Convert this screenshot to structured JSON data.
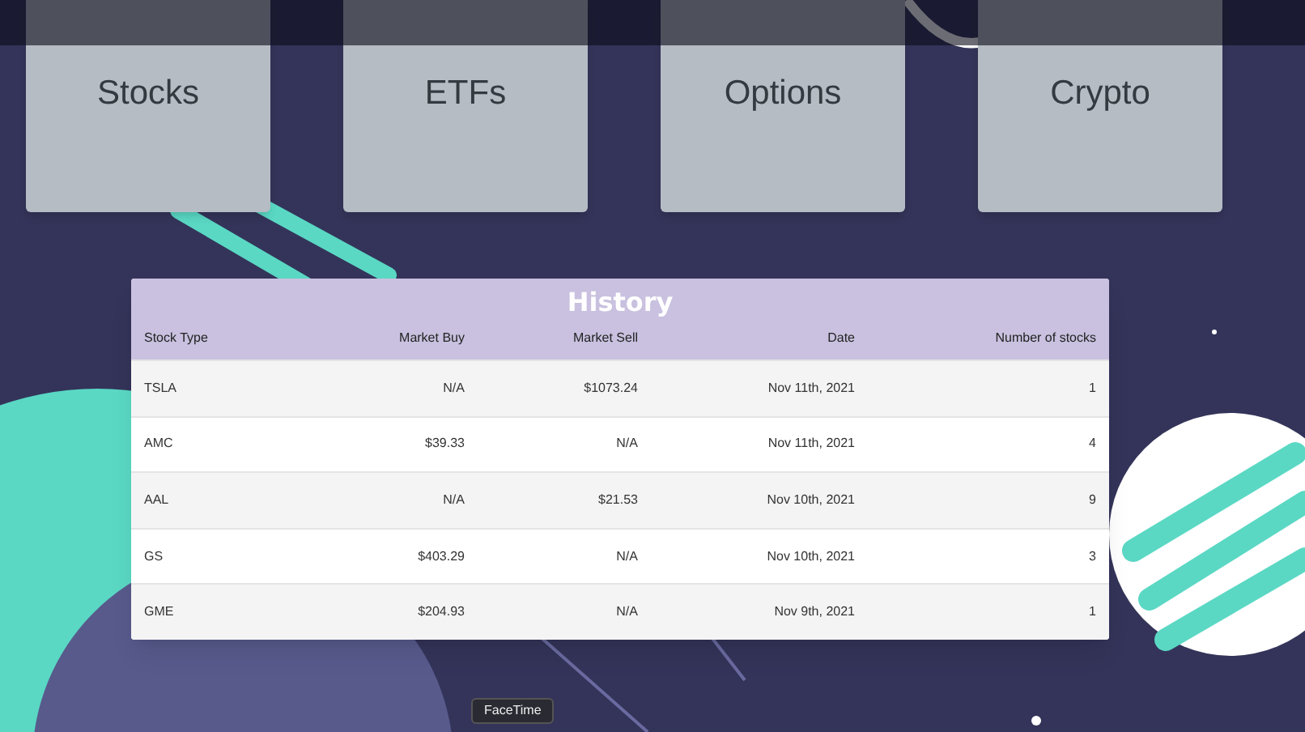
{
  "categories": [
    {
      "label": "Stocks"
    },
    {
      "label": "ETFs"
    },
    {
      "label": "Options"
    },
    {
      "label": "Crypto"
    }
  ],
  "history": {
    "title": "History",
    "columns": [
      "Stock Type",
      "Market Buy",
      "Market Sell",
      "Date",
      "Number of stocks"
    ],
    "rows": [
      [
        "TSLA",
        "N/A",
        "$1073.24",
        "Nov 11th, 2021",
        "1"
      ],
      [
        "AMC",
        "$39.33",
        "N/A",
        "Nov 11th, 2021",
        "4"
      ],
      [
        "AAL",
        "N/A",
        "$21.53",
        "Nov 10th, 2021",
        "9"
      ],
      [
        "GS",
        "$403.29",
        "N/A",
        "Nov 10th, 2021",
        "3"
      ],
      [
        "GME",
        "$204.93",
        "N/A",
        "Nov 9th, 2021",
        "1"
      ]
    ]
  },
  "tooltip": {
    "label": "FaceTime"
  }
}
